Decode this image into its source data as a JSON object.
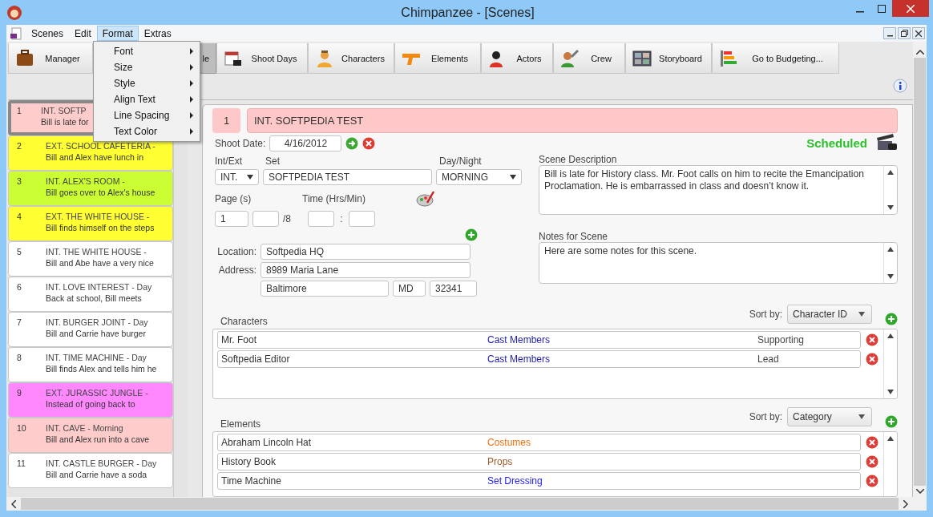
{
  "window": {
    "title": "Chimpanzee - [Scenes]"
  },
  "menu": [
    {
      "label": "Scenes",
      "selected": false
    },
    {
      "label": "Edit",
      "selected": false
    },
    {
      "label": "Format",
      "selected": true
    },
    {
      "label": "Extras",
      "selected": false
    }
  ],
  "format_menu": [
    {
      "label": "Font"
    },
    {
      "label": "Size"
    },
    {
      "label": "Style"
    },
    {
      "label": "Align Text"
    },
    {
      "label": "Line Spacing"
    },
    {
      "label": "Text Color"
    }
  ],
  "toolbar": [
    {
      "label": "Manager",
      "selected": false
    },
    {
      "label": "le",
      "selected": true
    },
    {
      "label": "Shoot Days",
      "selected": false
    },
    {
      "label": "Characters",
      "selected": false
    },
    {
      "label": "Elements",
      "selected": false
    },
    {
      "label": "Actors",
      "selected": false
    },
    {
      "label": "Crew",
      "selected": false
    },
    {
      "label": "Storyboard",
      "selected": false
    },
    {
      "label": "Go to Budgeting...",
      "selected": false
    }
  ],
  "scenes": [
    {
      "number": "1",
      "heading": "INT. SOFTP",
      "summary": "Bill is late for",
      "color": "#ffcccc",
      "selected": true
    },
    {
      "number": "2",
      "heading": "EXT. SCHOOL CAFETERIA -",
      "summary": "Bill and Alex have lunch in",
      "color": "#ffff33",
      "selected": false
    },
    {
      "number": "3",
      "heading": "INT. ALEX'S ROOM -",
      "summary": "Bill goes over to Alex's house",
      "color": "#ccff33",
      "selected": false
    },
    {
      "number": "4",
      "heading": "EXT. THE WHITE HOUSE -",
      "summary": "Bill finds himself on the steps",
      "color": "#ffff33",
      "selected": false
    },
    {
      "number": "5",
      "heading": "INT. THE WHITE HOUSE -",
      "summary": "Bill and Abe have a very nice",
      "color": "#ffffff",
      "selected": false
    },
    {
      "number": "6",
      "heading": "INT. LOVE INTEREST - Day",
      "summary": "Back at school, Bill meets",
      "color": "#ffffff",
      "selected": false
    },
    {
      "number": "7",
      "heading": "INT. BURGER JOINT - Day",
      "summary": "Bill and Carrie have burger",
      "color": "#ffffff",
      "selected": false
    },
    {
      "number": "8",
      "heading": "INT. TIME MACHINE - Day",
      "summary": "Bill finds Alex and tells him he",
      "color": "#ffffff",
      "selected": false
    },
    {
      "number": "9",
      "heading": "EXT. JURASSIC JUNGLE -",
      "summary": "Instead of going back to",
      "color": "#ff88ff",
      "selected": false
    },
    {
      "number": "10",
      "heading": "INT. CAVE - Morning",
      "summary": "Bill and Alex run into a cave",
      "color": "#ffcccc",
      "selected": false
    },
    {
      "number": "11",
      "heading": "INT. CASTLE BURGER - Day",
      "summary": "Bill and Carrie have a soda",
      "color": "#ffffff",
      "selected": false
    }
  ],
  "scene_header": {
    "number": "1",
    "title": "INT. SOFTPEDIA TEST"
  },
  "shoot_date": {
    "label": "Shoot Date:",
    "value": "4/16/2012"
  },
  "status": "Scheduled",
  "int_ext": {
    "label": "Int/Ext",
    "value": "INT."
  },
  "set": {
    "label": "Set",
    "value": "SOFTPEDIA TEST"
  },
  "day_night": {
    "label": "Day/Night",
    "value": "MORNING"
  },
  "pages": {
    "label": "Page (s)",
    "value": "1",
    "suffix": "/8"
  },
  "time": {
    "label": "Time (Hrs/Min)",
    "separator": ":"
  },
  "location": {
    "label": "Location:",
    "value": "Softpedia HQ"
  },
  "address": {
    "label": "Address:",
    "street": "8989 Maria Lane",
    "city": "Baltimore",
    "state": "MD",
    "zip": "32341"
  },
  "scene_description": {
    "label": "Scene Description",
    "value": "Bill is late for History class. Mr. Foot calls on him to recite the Emancipation Proclamation. He is embarrassed in class and doesn’t know it."
  },
  "notes": {
    "label": "Notes for Scene",
    "value": "Here are some notes for this scene."
  },
  "characters": {
    "label": "Characters",
    "sort_label": "Sort by:",
    "sort_value": "Character ID",
    "rows": [
      {
        "name": "Mr. Foot",
        "category": "Cast Members",
        "color": "#1c1cb0",
        "role": "Supporting"
      },
      {
        "name": "Softpedia Editor",
        "category": "Cast Members",
        "color": "#1c1cb0",
        "role": "Lead"
      }
    ]
  },
  "elements": {
    "label": "Elements",
    "sort_label": "Sort by:",
    "sort_value": "Category",
    "rows": [
      {
        "name": "Abraham Lincoln Hat",
        "category": "Costumes",
        "color": "#f07010"
      },
      {
        "name": "History Book",
        "category": "Props",
        "color": "#a05a28"
      },
      {
        "name": "Time Machine",
        "category": "Set Dressing",
        "color": "#1c1cf0"
      }
    ]
  }
}
